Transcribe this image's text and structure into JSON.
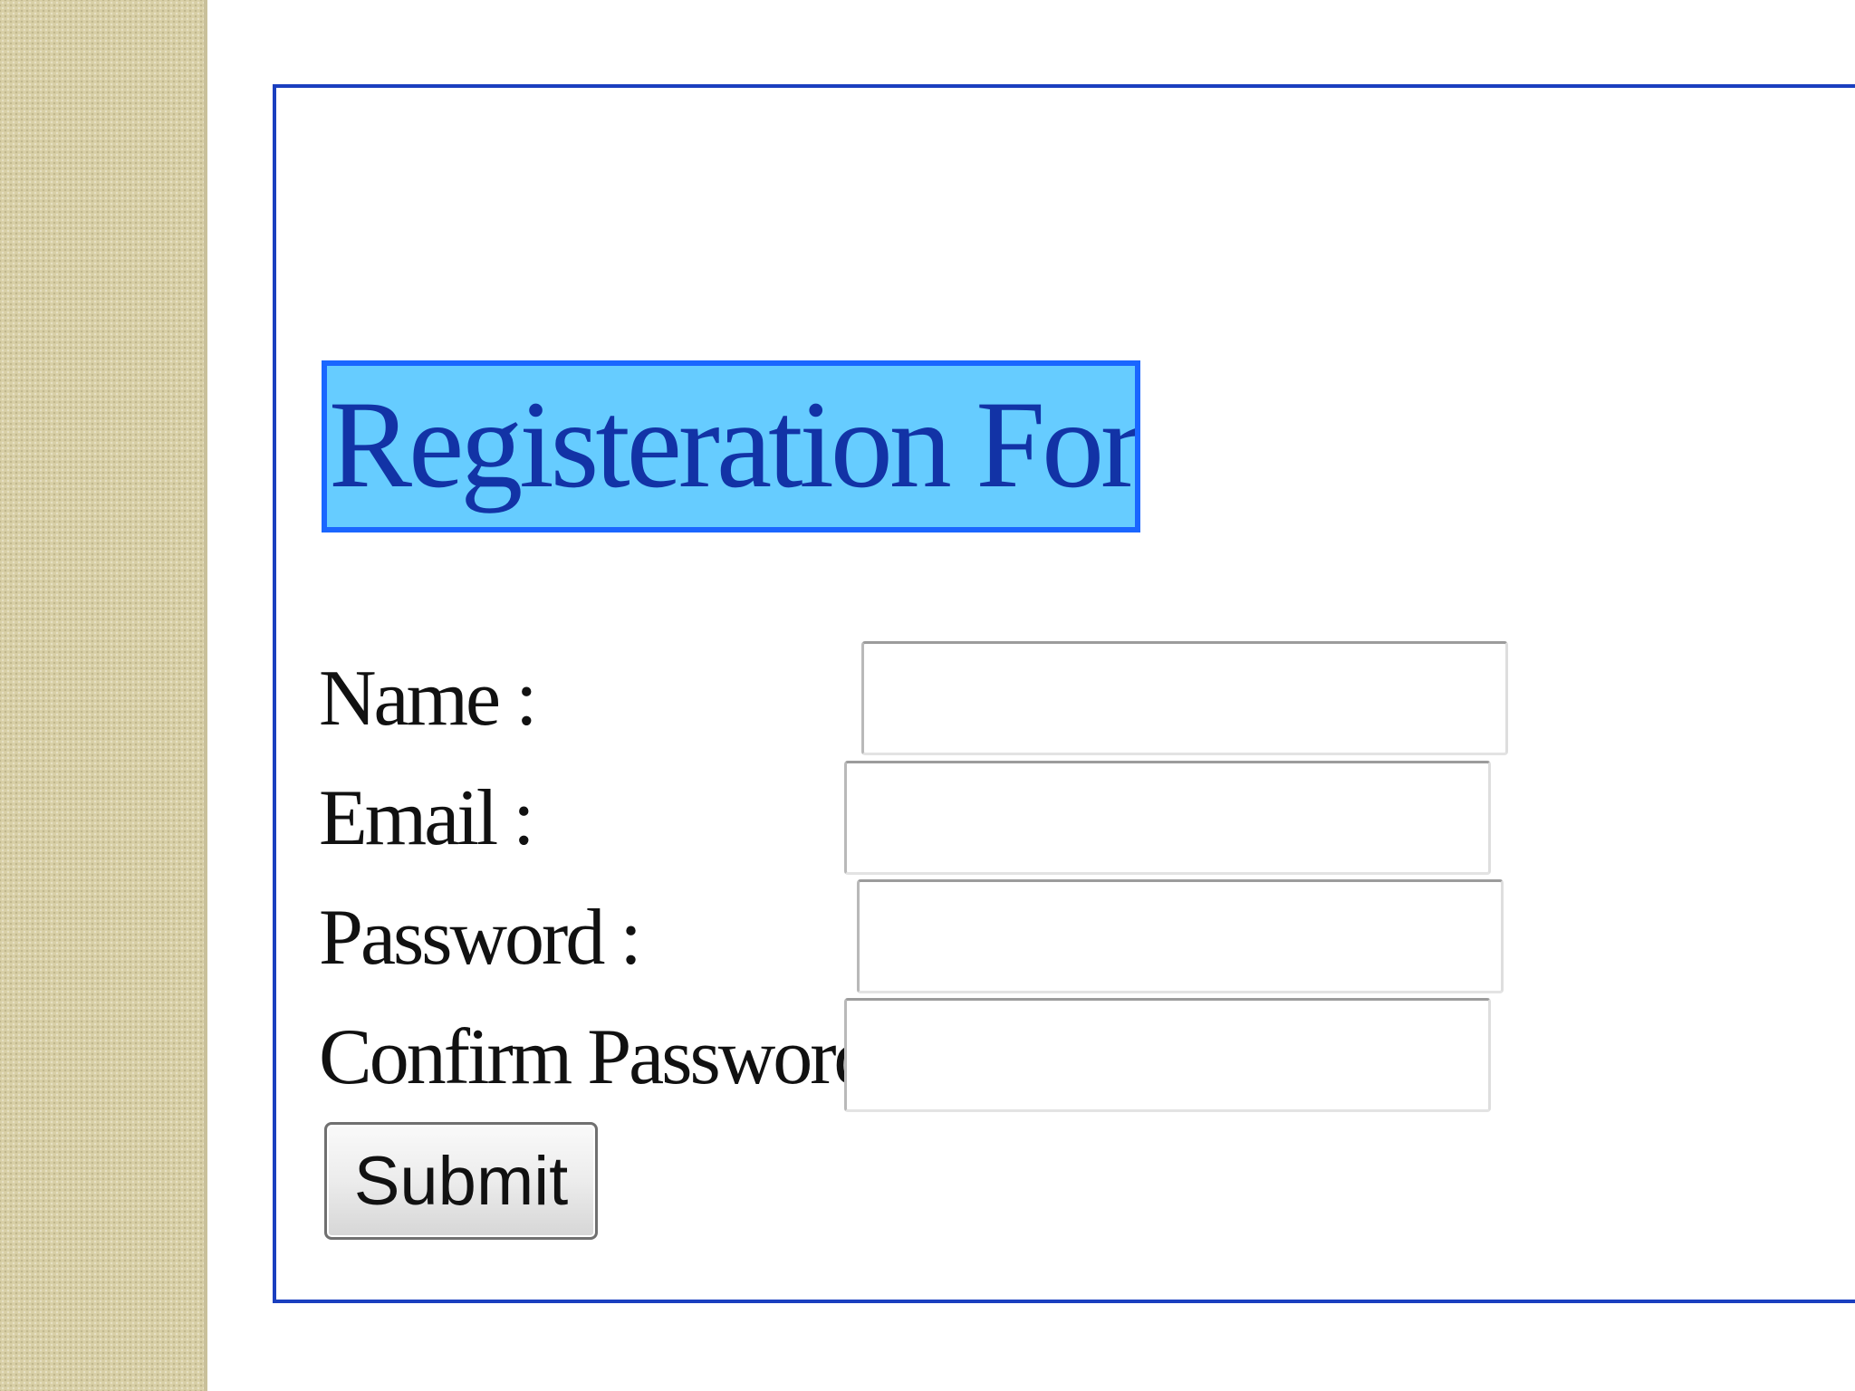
{
  "form": {
    "title": "Registeration Form",
    "fields": [
      {
        "label": "Name :",
        "value": ""
      },
      {
        "label": "Email :",
        "value": ""
      },
      {
        "label": "Password :",
        "value": ""
      },
      {
        "label": "Confirm Password:",
        "value": ""
      }
    ],
    "submit_label": "Submit"
  },
  "colors": {
    "frame_border": "#1a3fbf",
    "title_background": "#66ccff",
    "title_border": "#1a66ff",
    "title_text": "#1233a6",
    "side_strip": "#d8cfa6"
  }
}
